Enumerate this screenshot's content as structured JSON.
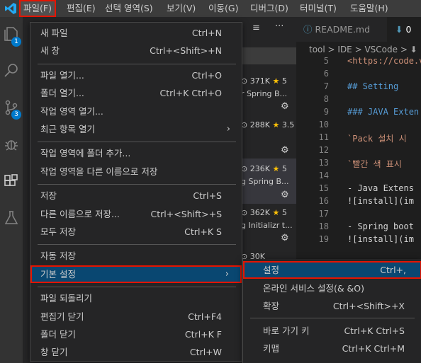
{
  "menubar": {
    "items": [
      {
        "label": "파일(F)"
      },
      {
        "label": "편집(E)"
      },
      {
        "label": "선택 영역(S)"
      },
      {
        "label": "보기(V)"
      },
      {
        "label": "이동(G)"
      },
      {
        "label": "디버그(D)"
      },
      {
        "label": "터미널(T)"
      },
      {
        "label": "도움말(H)"
      }
    ]
  },
  "activity": {
    "badges": [
      "1",
      "3"
    ]
  },
  "sidebar": {
    "ext_rows": [
      {
        "downloads": "371K",
        "rating": "5",
        "desc": "r Spring B..."
      },
      {
        "downloads": "288K",
        "rating": "3.5",
        "desc": ""
      },
      {
        "downloads": "236K",
        "rating": "5",
        "desc": "g Spring B..."
      },
      {
        "downloads": "362K",
        "rating": "5",
        "desc": "g Initializr t..."
      },
      {
        "downloads": "30K",
        "rating": "",
        "desc": ""
      }
    ],
    "toolbar_more": "···"
  },
  "editor": {
    "tabs": [
      {
        "label": "README.md"
      },
      {
        "label": "0"
      }
    ],
    "breadcrumb": "tool > IDE > VSCode > ⬇",
    "lines": [
      {
        "num": "5",
        "text": "<https://code.v",
        "color": "#ce9178"
      },
      {
        "num": "6",
        "text": "",
        "color": "#d4d4d4"
      },
      {
        "num": "7",
        "text": "## Setting",
        "color": "#569cd6"
      },
      {
        "num": "8",
        "text": "",
        "color": "#d4d4d4"
      },
      {
        "num": "9",
        "text": "### JAVA Exten",
        "color": "#569cd6"
      },
      {
        "num": "10",
        "text": "",
        "color": "#d4d4d4"
      },
      {
        "num": "11",
        "text": "`Pack 설치 시",
        "color": "#ce9178"
      },
      {
        "num": "12",
        "text": "",
        "color": "#d4d4d4"
      },
      {
        "num": "13",
        "text": "`빨간 색 표시 ​",
        "color": "#ce9178"
      },
      {
        "num": "14",
        "text": "",
        "color": "#d4d4d4"
      },
      {
        "num": "15",
        "text": "- Java Extens",
        "color": "#d4d4d4"
      },
      {
        "num": "16",
        "text": "![install](im",
        "color": "#d4d4d4"
      },
      {
        "num": "17",
        "text": "",
        "color": "#d4d4d4"
      },
      {
        "num": "18",
        "text": "- Spring boot",
        "color": "#d4d4d4"
      },
      {
        "num": "19",
        "text": "![install](im",
        "color": "#d4d4d4"
      }
    ]
  },
  "file_menu": {
    "groups": [
      [
        {
          "label": "새 파일",
          "key": "Ctrl+N"
        },
        {
          "label": "새 창",
          "key": "Ctrl+<Shift>+N"
        }
      ],
      [
        {
          "label": "파일 열기...",
          "key": "Ctrl+O"
        },
        {
          "label": "폴더 열기...",
          "key": "Ctrl+K Ctrl+O"
        },
        {
          "label": "작업 영역 열기...",
          "key": ""
        },
        {
          "label": "최근 항목 열기",
          "key": "",
          "arrow": "›"
        }
      ],
      [
        {
          "label": "작업 영역에 폴더 추가...",
          "key": ""
        },
        {
          "label": "작업 영역을 다른 이름으로 저장",
          "key": ""
        }
      ],
      [
        {
          "label": "저장",
          "key": "Ctrl+S"
        },
        {
          "label": "다른 이름으로 저장...",
          "key": "Ctrl+<Shift>+S"
        },
        {
          "label": "모두 저장",
          "key": "Ctrl+K S"
        }
      ],
      [
        {
          "label": "자동 저장",
          "key": ""
        },
        {
          "label": "기본 설정",
          "key": "",
          "arrow": "›"
        }
      ],
      [
        {
          "label": "파일 되돌리기",
          "key": ""
        },
        {
          "label": "편집기 닫기",
          "key": "Ctrl+F4"
        },
        {
          "label": "폴더 닫기",
          "key": "Ctrl+K F"
        },
        {
          "label": "창 닫기",
          "key": "Ctrl+W"
        }
      ]
    ]
  },
  "prefs_submenu": {
    "items": [
      {
        "label": "설정",
        "key": "Ctrl+,"
      },
      {
        "label": "온라인 서비스 설정(& &O)",
        "key": ""
      },
      {
        "label": "확장",
        "key": "Ctrl+<Shift>+X"
      },
      {
        "label": "바로 가기 키",
        "key": "Ctrl+K Ctrl+S"
      },
      {
        "label": "키맵",
        "key": "Ctrl+K Ctrl+M"
      }
    ]
  }
}
